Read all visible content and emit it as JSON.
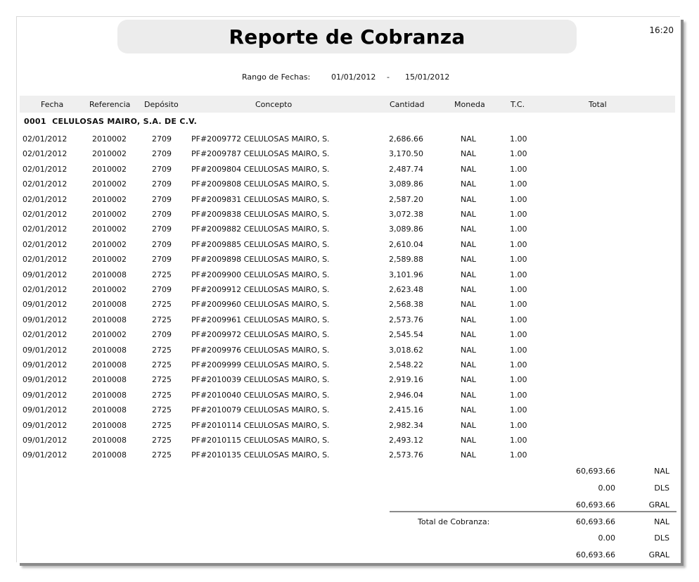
{
  "report": {
    "title": "Reporte de Cobranza",
    "time": "16:20",
    "range_label": "Rango de Fechas:",
    "range_from": "01/01/2012",
    "range_sep": "-",
    "range_to": "15/01/2012"
  },
  "columns": {
    "fecha": "Fecha",
    "referencia": "Referencia",
    "deposito": "Depósito",
    "concepto": "Concepto",
    "cantidad": "Cantidad",
    "moneda": "Moneda",
    "tc": "T.C.",
    "total": "Total"
  },
  "group": {
    "code": "0001",
    "name": "CELULOSAS MAIRO, S.A. DE C.V."
  },
  "rows": [
    {
      "fecha": "02/01/2012",
      "ref": "2010002",
      "dep": "2709",
      "concepto": "PF#2009772 CELULOSAS MAIRO, S.",
      "cantidad": "2,686.66",
      "moneda": "NAL",
      "tc": "1.00"
    },
    {
      "fecha": "02/01/2012",
      "ref": "2010002",
      "dep": "2709",
      "concepto": "PF#2009787 CELULOSAS MAIRO, S.",
      "cantidad": "3,170.50",
      "moneda": "NAL",
      "tc": "1.00"
    },
    {
      "fecha": "02/01/2012",
      "ref": "2010002",
      "dep": "2709",
      "concepto": "PF#2009804 CELULOSAS MAIRO, S.",
      "cantidad": "2,487.74",
      "moneda": "NAL",
      "tc": "1.00"
    },
    {
      "fecha": "02/01/2012",
      "ref": "2010002",
      "dep": "2709",
      "concepto": "PF#2009808 CELULOSAS MAIRO, S.",
      "cantidad": "3,089.86",
      "moneda": "NAL",
      "tc": "1.00"
    },
    {
      "fecha": "02/01/2012",
      "ref": "2010002",
      "dep": "2709",
      "concepto": "PF#2009831 CELULOSAS MAIRO, S.",
      "cantidad": "2,587.20",
      "moneda": "NAL",
      "tc": "1.00"
    },
    {
      "fecha": "02/01/2012",
      "ref": "2010002",
      "dep": "2709",
      "concepto": "PF#2009838 CELULOSAS MAIRO, S.",
      "cantidad": "3,072.38",
      "moneda": "NAL",
      "tc": "1.00"
    },
    {
      "fecha": "02/01/2012",
      "ref": "2010002",
      "dep": "2709",
      "concepto": "PF#2009882 CELULOSAS MAIRO, S.",
      "cantidad": "3,089.86",
      "moneda": "NAL",
      "tc": "1.00"
    },
    {
      "fecha": "02/01/2012",
      "ref": "2010002",
      "dep": "2709",
      "concepto": "PF#2009885 CELULOSAS MAIRO, S.",
      "cantidad": "2,610.04",
      "moneda": "NAL",
      "tc": "1.00"
    },
    {
      "fecha": "02/01/2012",
      "ref": "2010002",
      "dep": "2709",
      "concepto": "PF#2009898 CELULOSAS MAIRO, S.",
      "cantidad": "2,589.88",
      "moneda": "NAL",
      "tc": "1.00"
    },
    {
      "fecha": "09/01/2012",
      "ref": "2010008",
      "dep": "2725",
      "concepto": "PF#2009900 CELULOSAS MAIRO, S.",
      "cantidad": "3,101.96",
      "moneda": "NAL",
      "tc": "1.00"
    },
    {
      "fecha": "02/01/2012",
      "ref": "2010002",
      "dep": "2709",
      "concepto": "PF#2009912 CELULOSAS MAIRO, S.",
      "cantidad": "2,623.48",
      "moneda": "NAL",
      "tc": "1.00"
    },
    {
      "fecha": "09/01/2012",
      "ref": "2010008",
      "dep": "2725",
      "concepto": "PF#2009960 CELULOSAS MAIRO, S.",
      "cantidad": "2,568.38",
      "moneda": "NAL",
      "tc": "1.00"
    },
    {
      "fecha": "09/01/2012",
      "ref": "2010008",
      "dep": "2725",
      "concepto": "PF#2009961 CELULOSAS MAIRO, S.",
      "cantidad": "2,573.76",
      "moneda": "NAL",
      "tc": "1.00"
    },
    {
      "fecha": "02/01/2012",
      "ref": "2010002",
      "dep": "2709",
      "concepto": "PF#2009972 CELULOSAS MAIRO, S.",
      "cantidad": "2,545.54",
      "moneda": "NAL",
      "tc": "1.00"
    },
    {
      "fecha": "09/01/2012",
      "ref": "2010008",
      "dep": "2725",
      "concepto": "PF#2009976 CELULOSAS MAIRO, S.",
      "cantidad": "3,018.62",
      "moneda": "NAL",
      "tc": "1.00"
    },
    {
      "fecha": "09/01/2012",
      "ref": "2010008",
      "dep": "2725",
      "concepto": "PF#2009999 CELULOSAS MAIRO, S.",
      "cantidad": "2,548.22",
      "moneda": "NAL",
      "tc": "1.00"
    },
    {
      "fecha": "09/01/2012",
      "ref": "2010008",
      "dep": "2725",
      "concepto": "PF#2010039 CELULOSAS MAIRO, S.",
      "cantidad": "2,919.16",
      "moneda": "NAL",
      "tc": "1.00"
    },
    {
      "fecha": "09/01/2012",
      "ref": "2010008",
      "dep": "2725",
      "concepto": "PF#2010040 CELULOSAS MAIRO, S.",
      "cantidad": "2,946.04",
      "moneda": "NAL",
      "tc": "1.00"
    },
    {
      "fecha": "09/01/2012",
      "ref": "2010008",
      "dep": "2725",
      "concepto": "PF#2010079 CELULOSAS MAIRO, S.",
      "cantidad": "2,415.16",
      "moneda": "NAL",
      "tc": "1.00"
    },
    {
      "fecha": "09/01/2012",
      "ref": "2010008",
      "dep": "2725",
      "concepto": "PF#2010114 CELULOSAS MAIRO, S.",
      "cantidad": "2,982.34",
      "moneda": "NAL",
      "tc": "1.00"
    },
    {
      "fecha": "09/01/2012",
      "ref": "2010008",
      "dep": "2725",
      "concepto": "PF#2010115 CELULOSAS MAIRO, S.",
      "cantidad": "2,493.12",
      "moneda": "NAL",
      "tc": "1.00"
    },
    {
      "fecha": "09/01/2012",
      "ref": "2010008",
      "dep": "2725",
      "concepto": "PF#2010135 CELULOSAS MAIRO, S.",
      "cantidad": "2,573.76",
      "moneda": "NAL",
      "tc": "1.00"
    }
  ],
  "group_totals": [
    {
      "amount": "60,693.66",
      "currency": "NAL"
    },
    {
      "amount": "0.00",
      "currency": "DLS"
    },
    {
      "amount": "60,693.66",
      "currency": "GRAL"
    }
  ],
  "grand_label": "Total de Cobranza:",
  "grand_totals": [
    {
      "amount": "60,693.66",
      "currency": "NAL"
    },
    {
      "amount": "0.00",
      "currency": "DLS"
    },
    {
      "amount": "60,693.66",
      "currency": "GRAL"
    }
  ]
}
